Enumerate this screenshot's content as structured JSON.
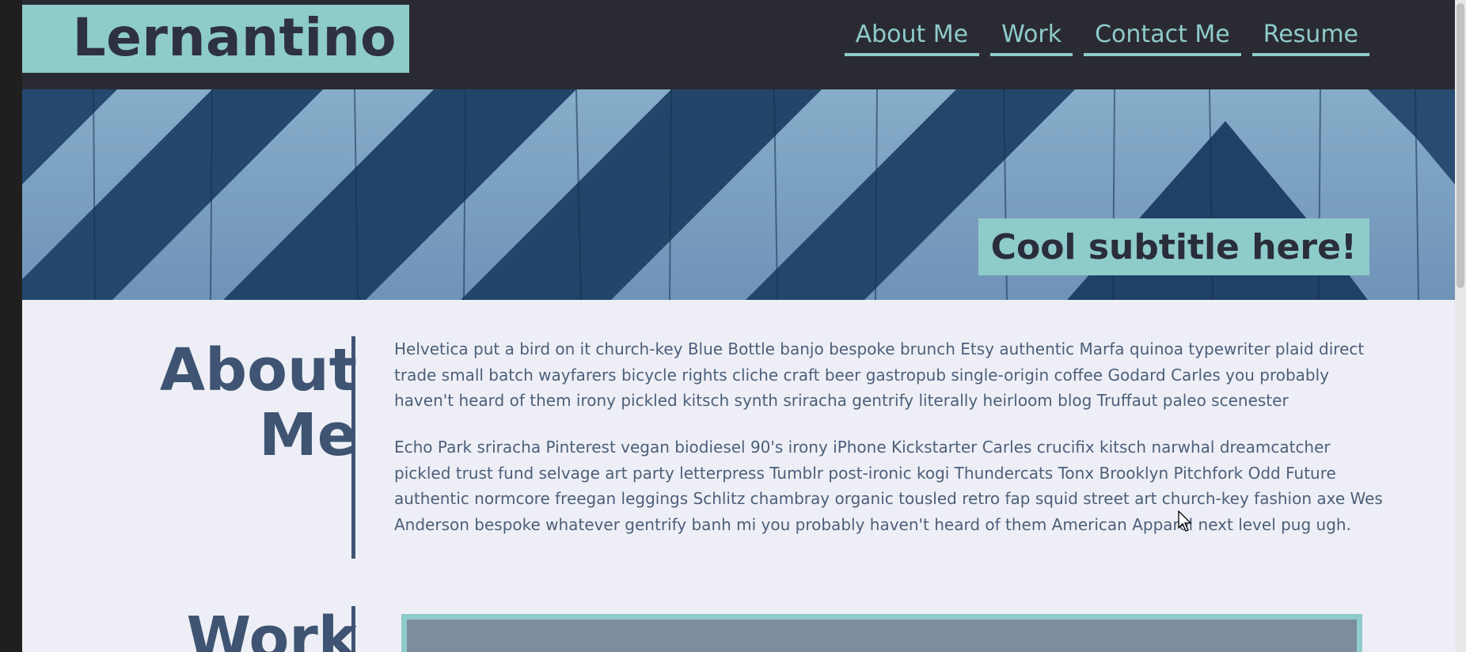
{
  "site": {
    "logo": "Lernantino"
  },
  "nav": {
    "items": [
      "About Me",
      "Work",
      "Contact Me",
      "Resume"
    ]
  },
  "hero": {
    "subtitle": "Cool subtitle here!"
  },
  "about": {
    "title_line1": "About",
    "title_line2": "Me",
    "paragraphs": [
      "Helvetica put a bird on it church-key Blue Bottle banjo bespoke brunch Etsy authentic Marfa quinoa typewriter plaid direct trade small batch wayfarers bicycle rights cliche craft beer gastropub single-origin coffee Godard Carles you probably haven't heard of them irony pickled kitsch synth sriracha gentrify literally heirloom blog Truffaut paleo scenester",
      "Echo Park sriracha Pinterest vegan biodiesel 90's irony iPhone Kickstarter Carles crucifix kitsch narwhal dreamcatcher pickled trust fund selvage art party letterpress Tumblr post-ironic kogi Thundercats Tonx Brooklyn Pitchfork Odd Future authentic normcore freegan leggings Schlitz chambray organic tousled retro fap squid street art church-key fashion axe Wes Anderson bespoke whatever gentrify banh mi you probably haven't heard of them American Apparel next level pug ugh."
    ]
  },
  "work": {
    "title": "Work"
  },
  "colors": {
    "accent": "#8ecbcb",
    "header_bg": "#2a2b32",
    "heading": "#3e5472",
    "body_text": "#4c5f79",
    "page_bg": "#eeeff6"
  }
}
